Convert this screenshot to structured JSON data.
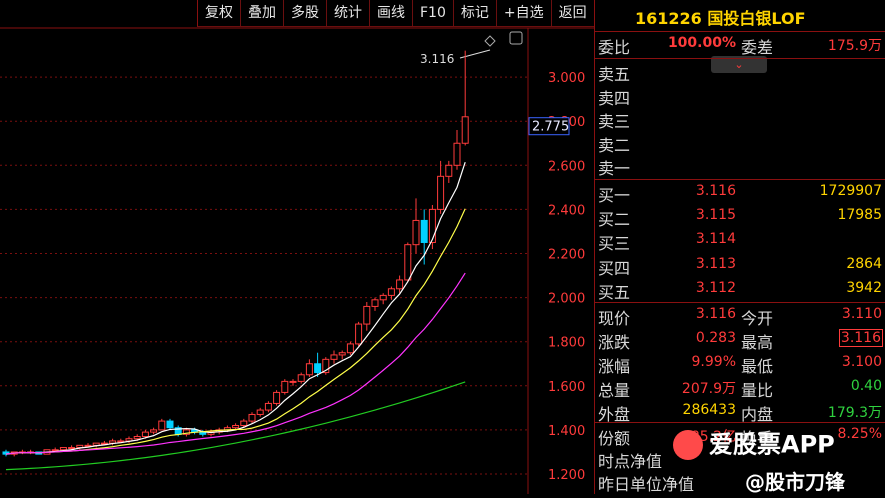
{
  "toolbar": {
    "items": [
      "复权",
      "叠加",
      "多股",
      "统计",
      "画线",
      "F10",
      "标记",
      "+自选",
      "返回"
    ]
  },
  "chart": {
    "price_ticks": [
      "3.000",
      "2.800",
      "2.600",
      "2.400",
      "2.200",
      "2.000",
      "1.800",
      "1.600",
      "1.400",
      "1.200"
    ],
    "current_price_label": "2.775",
    "high_marker": "3.116",
    "colors": {
      "up": "#ff3b3b",
      "down": "#00d0ff",
      "ma1": "#ffffff",
      "ma2": "#ffff4a",
      "ma3": "#ff33ff",
      "ma4": "#22cc22",
      "grid": "#7a0f0f"
    }
  },
  "panel": {
    "code": "161226",
    "name": "国投白银LOF",
    "weibi_label": "委比",
    "weibi_value": "100.00%",
    "weicha_label": "委差",
    "weicha_value": "175.9万",
    "sell": [
      {
        "label": "卖五"
      },
      {
        "label": "卖四"
      },
      {
        "label": "卖三"
      },
      {
        "label": "卖二"
      },
      {
        "label": "卖一"
      }
    ],
    "buy": [
      {
        "label": "买一",
        "price": "3.116",
        "vol": "1729907"
      },
      {
        "label": "买二",
        "price": "3.115",
        "vol": "17985"
      },
      {
        "label": "买三",
        "price": "3.114",
        "vol": ""
      },
      {
        "label": "买四",
        "price": "3.113",
        "vol": "2864"
      },
      {
        "label": "买五",
        "price": "3.112",
        "vol": "3942"
      }
    ],
    "stats": [
      {
        "l1": "现价",
        "v1": "3.116",
        "l2": "今开",
        "v2": "3.110"
      },
      {
        "l1": "涨跌",
        "v1": "0.283",
        "l2": "最高",
        "v2": "3.116"
      },
      {
        "l1": "涨幅",
        "v1": "9.99%",
        "l2": "最低",
        "v2": "3.100"
      },
      {
        "l1": "总量",
        "v1": "207.9万",
        "l2": "量比",
        "v2": "0.40"
      },
      {
        "l1": "外盘",
        "v1": "286433",
        "l2": "内盘",
        "v2": "179.3万"
      }
    ],
    "extra": [
      {
        "l1": "份额",
        "v1": "85.2亿",
        "l2": "换手",
        "v2": "8.25%"
      },
      {
        "l1": "时点净值",
        "v1": "",
        "l2": "",
        "v2": ""
      },
      {
        "l1": "昨日单位净值",
        "v1": "",
        "l2": "",
        "v2": ""
      }
    ]
  },
  "watermark": {
    "app": "爱股票APP",
    "author": "@股市刀锋"
  }
}
